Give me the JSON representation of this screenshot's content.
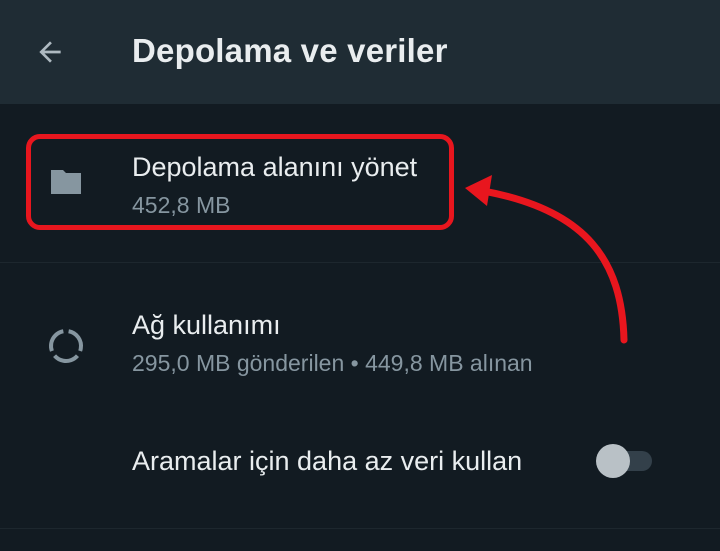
{
  "header": {
    "title": "Depolama ve veriler",
    "back_icon": "arrow-left-icon"
  },
  "settings": {
    "storage": {
      "title": "Depolama alanını yönet",
      "subtitle": "452,8 MB",
      "icon": "folder-icon"
    },
    "network": {
      "title": "Ağ kullanımı",
      "subtitle": "295,0 MB gönderilen • 449,8 MB alınan",
      "icon": "data-usage-icon"
    },
    "calls": {
      "title": "Aramalar için daha az veri kullan",
      "toggle_on": false
    }
  },
  "annotation": {
    "color": "#e8161e"
  },
  "colors": {
    "background": "#121b22",
    "appbar": "#1f2c34",
    "primary_text": "#e9edef",
    "secondary_text": "#8696a0"
  }
}
